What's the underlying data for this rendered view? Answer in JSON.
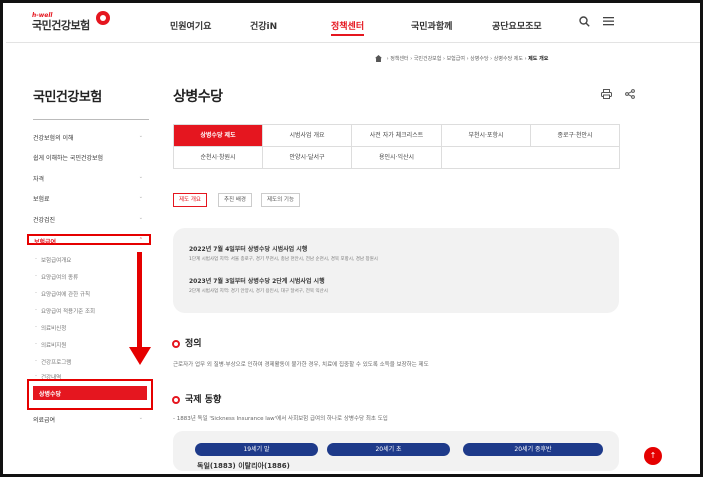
{
  "header": {
    "logo_sub": "h-well",
    "logo_main": "국민건강보험",
    "nav": [
      "민원여기요",
      "건강iN",
      "정책센터",
      "국민과함께",
      "공단요모조모"
    ],
    "active_nav": 2,
    "search_icon": "search-icon",
    "menu_icon": "hamburger-menu-icon"
  },
  "breadcrumb": {
    "home_icon": "home-icon",
    "items": [
      "정책센터",
      "국민건강보험",
      "보험급여",
      "상병수당",
      "상병수당 제도",
      "제도 개요"
    ]
  },
  "sidebar": {
    "title": "국민건강보험",
    "items": [
      {
        "label": "건강보험의 이해",
        "chev": "⌄"
      },
      {
        "label": "쉽게 이해하는 국민건강보험",
        "chev": ""
      },
      {
        "label": "자격",
        "chev": "⌄"
      },
      {
        "label": "보험료",
        "chev": "⌄"
      },
      {
        "label": "건강검진",
        "chev": "⌄"
      }
    ],
    "active_group": {
      "label": "보험급여",
      "chev": "⌃"
    },
    "sub_items": [
      "보험급여개요",
      "요양급여의 종류",
      "요양급여에 관한 규칙",
      "요양급여 적용기준 조회",
      "의료비신청",
      "의료비지원",
      "건강프로그램",
      "건강내역"
    ],
    "selected_item": "상병수당",
    "after_items": [
      {
        "label": "의료급여",
        "chev": "⌄"
      }
    ]
  },
  "page": {
    "title": "상병수당",
    "print_icon": "print-icon",
    "share_icon": "share-icon",
    "tabs": [
      "상병수당 제도",
      "시범사업 개요",
      "사전 자가 체크리스트",
      "부천시·포항시",
      "종로구·천안시",
      "순천시·창원시",
      "안양시·달서구",
      "용인시·익산시"
    ],
    "pills": [
      "제도 개요",
      "추진 배경",
      "제도의 기능"
    ],
    "notices": [
      {
        "title": "2022년 7월 4일부터 상병수당 시범사업 시행",
        "sub": "1단계 시범사업 지역: 서울 종로구, 경기 부천시, 충남 천안시, 전남 순천시, 경북 포항시, 경남 창원시"
      },
      {
        "title": "2023년 7월 3일부터 상병수당 2단계 시범사업 시행",
        "sub": "2단계 시범사업 지역: 경기 안양시, 경기 용인시, 대구 달서구, 전북 익산시"
      }
    ],
    "def_title": "정의",
    "def_body": "근로자가 업무 외 질병·부상으로 인하여 경제활동이 불가한 경우, 치료에 집중할 수 있도록 소득을 보장하는 제도",
    "intl_title": "국제 동향",
    "intl_body": "- 1883년 독일 'Sickness Insurance law'에서 사회보험 급여의 하나로 상병수당 최초 도입",
    "eras": [
      "19세기 말",
      "20세기 초",
      "20세기 중후반"
    ],
    "era_below": "독일(1883) 이탈리아(1886)",
    "top_button": "↑"
  }
}
